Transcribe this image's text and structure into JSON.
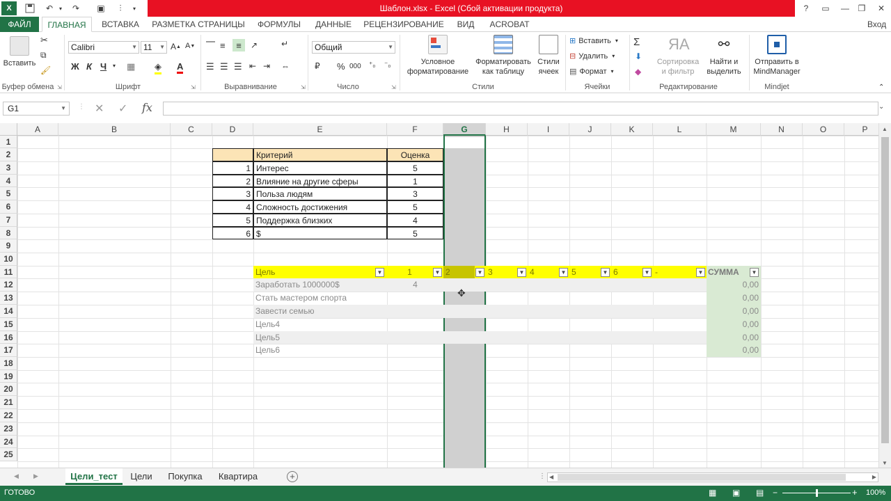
{
  "window": {
    "title": "Шаблон.xlsx - Excel (Сбой активации продукта)",
    "signin": "Вход"
  },
  "ribbon_tabs": [
    "ФАЙЛ",
    "ГЛАВНАЯ",
    "ВСТАВКА",
    "РАЗМЕТКА СТРАНИЦЫ",
    "ФОРМУЛЫ",
    "ДАННЫЕ",
    "РЕЦЕНЗИРОВАНИЕ",
    "ВИД",
    "ACROBAT"
  ],
  "ribbon": {
    "clipboard": {
      "paste": "Вставить",
      "label": "Буфер обмена"
    },
    "font": {
      "name": "Calibri",
      "size": "11",
      "bold": "Ж",
      "italic": "К",
      "underline": "Ч",
      "label": "Шрифт"
    },
    "alignment": {
      "label": "Выравнивание"
    },
    "number": {
      "format": "Общий",
      "percent": "%",
      "thousands": "000",
      "label": "Число"
    },
    "styles": {
      "conditional_line1": "Условное",
      "conditional_line2": "форматирование",
      "table_line1": "Форматировать",
      "table_line2": "как таблицу",
      "cell_line1": "Стили",
      "cell_line2": "ячеек",
      "label": "Стили"
    },
    "cells": {
      "insert": "Вставить",
      "delete": "Удалить",
      "format": "Формат",
      "label": "Ячейки"
    },
    "editing": {
      "sort_line1": "Сортировка",
      "sort_line2": "и фильтр",
      "find_line1": "Найти и",
      "find_line2": "выделить",
      "label": "Редактирование"
    },
    "mindjet": {
      "send_line1": "Отправить в",
      "send_line2": "MindManager",
      "label": "Mindjet"
    }
  },
  "formula_bar": {
    "name_box": "G1",
    "fx": "fx",
    "content": ""
  },
  "columns": [
    "A",
    "B",
    "C",
    "D",
    "E",
    "F",
    "G",
    "H",
    "I",
    "J",
    "K",
    "L",
    "M",
    "N",
    "O",
    "P"
  ],
  "rows": [
    "1",
    "2",
    "3",
    "4",
    "5",
    "6",
    "7",
    "8",
    "9",
    "10",
    "11",
    "12",
    "13",
    "14",
    "15",
    "16",
    "17",
    "18",
    "19",
    "20",
    "21",
    "22",
    "23",
    "24",
    "25"
  ],
  "criteria": {
    "header_name": "Критерий",
    "header_score": "Оценка",
    "items": [
      {
        "n": "1",
        "name": "Интерес",
        "score": "5"
      },
      {
        "n": "2",
        "name": "Влияние на другие сферы",
        "score": "1"
      },
      {
        "n": "3",
        "name": "Польза людям",
        "score": "3"
      },
      {
        "n": "4",
        "name": "Сложность достижения",
        "score": "5"
      },
      {
        "n": "5",
        "name": "Поддержка близких",
        "score": "4"
      },
      {
        "n": "6",
        "name": "$",
        "score": "5"
      }
    ]
  },
  "goals": {
    "header_goal": "Цель",
    "header_cols": [
      "1",
      "2",
      "3",
      "4",
      "5",
      "6",
      "-"
    ],
    "header_sum": "СУММА",
    "items": [
      {
        "name": "Заработать 1000000$",
        "c1": "4",
        "sum": "0,00"
      },
      {
        "name": "Стать мастером спорта",
        "c1": "",
        "sum": "0,00"
      },
      {
        "name": "Завести семью",
        "c1": "",
        "sum": "0,00"
      },
      {
        "name": "Цель4",
        "c1": "",
        "sum": "0,00"
      },
      {
        "name": "Цель5",
        "c1": "",
        "sum": "0,00"
      },
      {
        "name": "Цель6",
        "c1": "",
        "sum": "0,00"
      }
    ]
  },
  "sheets": [
    "Цели_тест",
    "Цели",
    "Покупка",
    "Квартира"
  ],
  "status": {
    "ready": "ГОТОВО",
    "zoom": "100%"
  },
  "colors": {
    "excel_green": "#217346",
    "title_red": "#e81123",
    "header_yellow": "#ffff00",
    "criteria_header": "#fce4b6",
    "sum_green": "#d9ead3"
  }
}
